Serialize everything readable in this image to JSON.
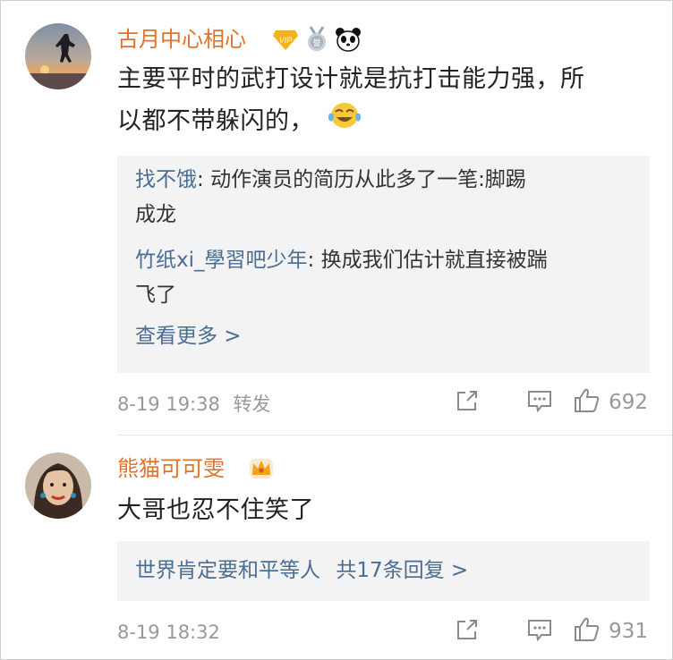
{
  "comments": [
    {
      "username": "古月中心相心",
      "badges": [
        "vip-diamond-icon",
        "medal-icon",
        "panda-icon"
      ],
      "text_line1": "主要平时的武打设计就是抗打击能力强，所",
      "text_line2": "以都不带躲闪的，",
      "emoji": "laugh-cry-emoji",
      "replies": [
        {
          "name": "找不饿",
          "sep": ": ",
          "text_line1": "动作演员的简历从此多了一笔:脚踢",
          "text_line2": "成龙"
        },
        {
          "name": "竹纸xi_學習吧少年",
          "sep": ": ",
          "text_line1": "换成我们估计就直接被踹",
          "text_line2": "飞了"
        }
      ],
      "more_label": "查看更多 >",
      "time": "8-19 19:38",
      "forward_label": "转发",
      "like_count": "692"
    },
    {
      "username": "熊猫可可雯",
      "badges": [
        "crown-icon"
      ],
      "text_line1": "大哥也忍不住笑了",
      "reply_summary_names": "世界肯定要和平等人",
      "reply_summary_count": "共17条回复 >",
      "time": "8-19 18:32",
      "like_count": "931"
    }
  ],
  "colors": {
    "username": "#e0722b",
    "reply_name": "#4a6d94",
    "meta": "#999999",
    "reply_bg": "#f3f3f3"
  }
}
